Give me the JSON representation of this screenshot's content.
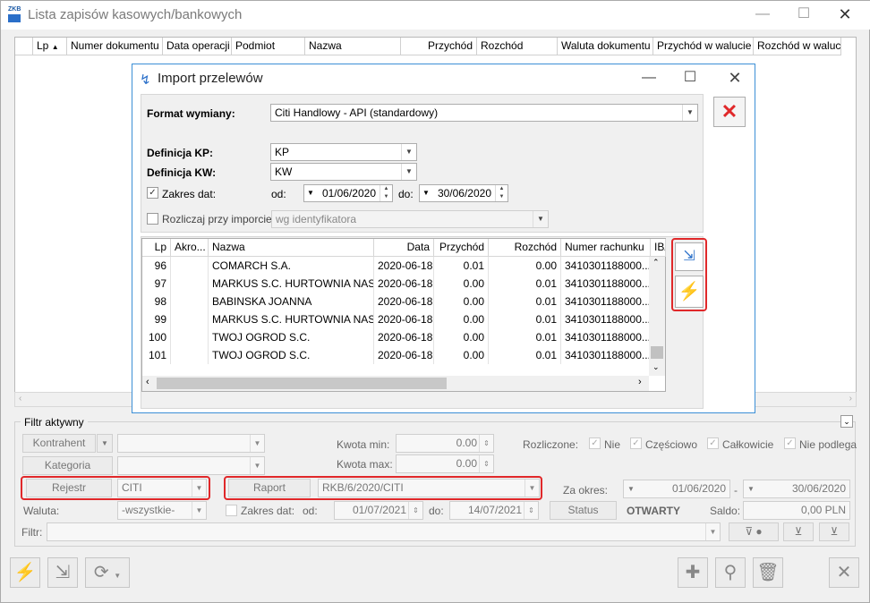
{
  "window": {
    "title": "Lista zapisów kasowych/bankowych",
    "logo": "ZKB"
  },
  "grid": {
    "columns": [
      "Lp",
      "Numer dokumentu",
      "Data operacji",
      "Podmiot",
      "Nazwa",
      "Przychód",
      "Rozchód",
      "Waluta dokumentu",
      "Przychód w walucie",
      "Rozchód w walucie"
    ]
  },
  "filter": {
    "title": "Filtr aktywny",
    "kontrahent_label": "Kontrahent",
    "kategoria_label": "Kategoria",
    "rejestr_label": "Rejestr",
    "rejestr_value": "CITI",
    "raport_label": "Raport",
    "raport_value": "RKB/6/2020/CITI",
    "waluta_label": "Waluta:",
    "waluta_value": "-wszystkie-",
    "zakres_label": "Zakres dat:",
    "od_label": "od:",
    "od_value": "01/07/2021",
    "do_label": "do:",
    "do_value": "14/07/2021",
    "filtr_label": "Filtr:",
    "kwota_min_label": "Kwota min:",
    "kwota_min_value": "0.00",
    "kwota_max_label": "Kwota max:",
    "kwota_max_value": "0.00",
    "rozliczone_label": "Rozliczone:",
    "opt_nie": "Nie",
    "opt_czesciowo": "Częściowo",
    "opt_calkowicie": "Całkowicie",
    "opt_nie_podlega": "Nie podlega",
    "za_okres_label": "Za okres:",
    "okres_od": "01/06/2020",
    "okres_do": "30/06/2020",
    "status_label": "Status",
    "status_value": "OTWARTY",
    "saldo_label": "Saldo:",
    "saldo_value": "0,00 PLN"
  },
  "dialog": {
    "title": "Import przelewów",
    "format_label": "Format wymiany:",
    "format_value": "Citi Handlowy - API  (standardowy)",
    "kp_label": "Definicja KP:",
    "kp_value": "KP",
    "kw_label": "Definicja KW:",
    "kw_value": "KW",
    "zakres_label": "Zakres dat:",
    "od_label": "od:",
    "od_value": "01/06/2020",
    "do_label": "do:",
    "do_value": "30/06/2020",
    "rozliczaj_label": "Rozliczaj przy imporcie:",
    "rozliczaj_value": "wg identyfikatora",
    "columns": [
      "Lp",
      "Akro...",
      "Nazwa",
      "Data",
      "Przychód",
      "Rozchód",
      "Numer rachunku",
      "IBA"
    ],
    "rows": [
      {
        "lp": "96",
        "akronim": "",
        "nazwa": "COMARCH S.A.",
        "data": "2020-06-18",
        "przychod": "0.01",
        "rozchod": "0.00",
        "rachunek": "3410301188000..."
      },
      {
        "lp": "97",
        "akronim": "",
        "nazwa": "MARKUS S.C. HURTOWNIA NASIO...",
        "data": "2020-06-18",
        "przychod": "0.00",
        "rozchod": "0.01",
        "rachunek": "3410301188000..."
      },
      {
        "lp": "98",
        "akronim": "",
        "nazwa": "BABINSKA JOANNA",
        "data": "2020-06-18",
        "przychod": "0.00",
        "rozchod": "0.01",
        "rachunek": "3410301188000..."
      },
      {
        "lp": "99",
        "akronim": "",
        "nazwa": "MARKUS S.C. HURTOWNIA NASIO...",
        "data": "2020-06-18",
        "przychod": "0.00",
        "rozchod": "0.01",
        "rachunek": "3410301188000..."
      },
      {
        "lp": "100",
        "akronim": "",
        "nazwa": "TWOJ OGROD S.C.",
        "data": "2020-06-18",
        "przychod": "0.00",
        "rozchod": "0.01",
        "rachunek": "3410301188000..."
      },
      {
        "lp": "101",
        "akronim": "",
        "nazwa": "TWOJ OGROD S.C.",
        "data": "2020-06-18",
        "przychod": "0.00",
        "rozchod": "0.01",
        "rachunek": "3410301188000..."
      }
    ]
  },
  "colors": {
    "accent_red": "#e0282a",
    "dialog_border": "#3c8fd6"
  }
}
